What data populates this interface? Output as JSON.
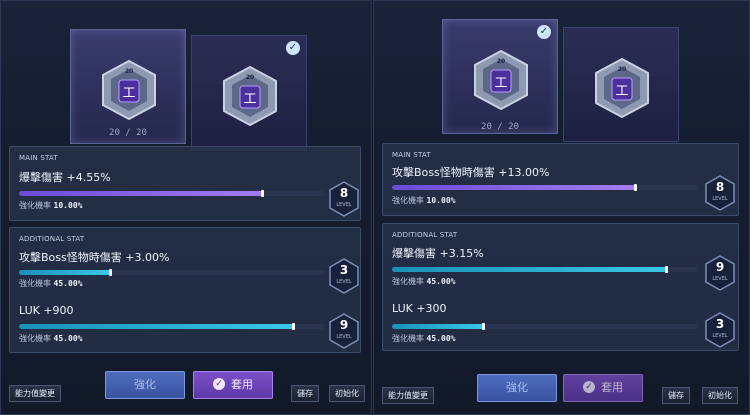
{
  "left": {
    "cards": [
      {
        "rank": "20",
        "glyph": "工",
        "selected": true,
        "checked": false
      },
      {
        "rank": "20",
        "glyph": "工",
        "selected": false,
        "checked": true
      }
    ],
    "count": "20 / 20",
    "main": {
      "title": "MAIN STAT",
      "label": "爆擊傷害 +4.55%",
      "progress": 0.8,
      "rate_label": "強化機率",
      "rate_value": "10.00%",
      "level": "8",
      "level_word": "LEVEL"
    },
    "additional": {
      "title": "ADDITIONAL STAT",
      "stats": [
        {
          "label": "攻擊Boss怪物時傷害 +3.00%",
          "progress": 0.3,
          "rate_label": "強化機率",
          "rate_value": "45.00%",
          "level": "3",
          "level_word": "LEVEL"
        },
        {
          "label": "LUK +900",
          "progress": 0.9,
          "rate_label": "強化機率",
          "rate_value": "45.00%",
          "level": "9",
          "level_word": "LEVEL"
        }
      ]
    },
    "buttons": {
      "change": "能力值變更",
      "enhance": "強化",
      "apply": "套用",
      "save": "儲存",
      "reset": "初始化"
    }
  },
  "right": {
    "cards": [
      {
        "rank": "20",
        "glyph": "工",
        "selected": true,
        "checked": true
      },
      {
        "rank": "20",
        "glyph": "工",
        "selected": false,
        "checked": false
      }
    ],
    "count": "20 / 20",
    "main": {
      "title": "MAIN STAT",
      "label": "攻擊Boss怪物時傷害 +13.00%",
      "progress": 0.8,
      "rate_label": "強化機率",
      "rate_value": "10.00%",
      "level": "8",
      "level_word": "LEVEL"
    },
    "additional": {
      "title": "ADDITIONAL STAT",
      "stats": [
        {
          "label": "爆擊傷害 +3.15%",
          "progress": 0.9,
          "rate_label": "強化機率",
          "rate_value": "45.00%",
          "level": "9",
          "level_word": "LEVEL"
        },
        {
          "label": "LUK +300",
          "progress": 0.3,
          "rate_label": "強化機率",
          "rate_value": "45.00%",
          "level": "3",
          "level_word": "LEVEL"
        }
      ]
    },
    "buttons": {
      "change": "能力值變更",
      "enhance": "強化",
      "apply": "套用",
      "save": "儲存",
      "reset": "初始化"
    }
  },
  "colors": {
    "accent_purple": "#a57cf5",
    "accent_cyan": "#39c8e8",
    "button_blue": "#4e6dbf",
    "button_purple": "#7c4fc8"
  },
  "icons": {
    "node": "hexagon-core-icon",
    "check": "checkmark-icon",
    "level": "level-badge-icon"
  }
}
